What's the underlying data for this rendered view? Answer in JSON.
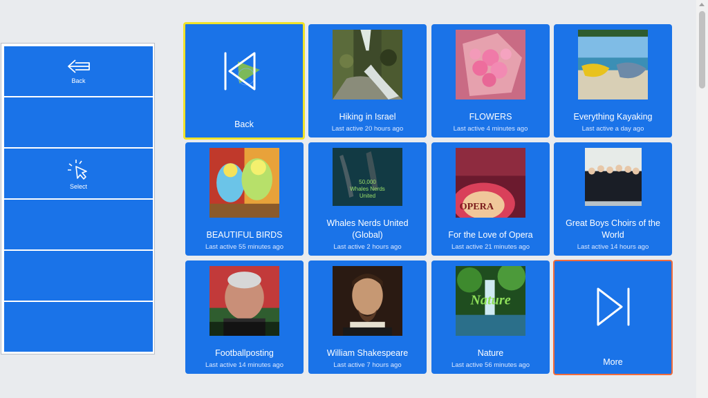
{
  "sidebar": {
    "back_label": "Back",
    "select_label": "Select",
    "back_icon": "arrow-left-icon",
    "select_icon": "pointer-click-icon"
  },
  "grid": {
    "back_tile": {
      "label": "Back",
      "icon": "skip-back-icon"
    },
    "more_tile": {
      "label": "More",
      "icon": "skip-forward-icon"
    },
    "groups": [
      {
        "name": "Hiking in Israel",
        "active": "Last active 20 hours ago",
        "thumb": "waterfall-forest"
      },
      {
        "name": "FLOWERS",
        "active": "Last active 4 minutes ago",
        "thumb": "pink-roses"
      },
      {
        "name": "Everything Kayaking",
        "active": "Last active a day ago",
        "thumb": "kayaks-beach"
      },
      {
        "name": "BEAUTIFUL BIRDS",
        "active": "Last active 55 minutes ago",
        "thumb": "parakeets"
      },
      {
        "name": "Whales Nerds United (Global)",
        "active": "Last active 2 hours ago",
        "thumb": "whales",
        "thumb_text": [
          "50,000",
          "Whales Nerds",
          "United"
        ]
      },
      {
        "name": "For the Love of Opera",
        "active": "Last active 21 minutes ago",
        "thumb": "opera-poster",
        "thumb_text": [
          "OPERA"
        ]
      },
      {
        "name": "Great Boys Choirs of the World",
        "active": "Last active 14 hours ago",
        "thumb": "boys-choir"
      },
      {
        "name": "Footballposting",
        "active": "Last active 14 minutes ago",
        "thumb": "football-man"
      },
      {
        "name": "William Shakespeare",
        "active": "Last active 7 hours ago",
        "thumb": "shakespeare-portrait"
      },
      {
        "name": "Nature",
        "active": "Last active 56 minutes ago",
        "thumb": "nature-waterfall",
        "thumb_text": [
          "Nature"
        ]
      }
    ]
  },
  "colors": {
    "tile": "#1a73e8",
    "selected_border": "#f0e22a",
    "hover_border": "#f26b3a",
    "background": "#e9ebee"
  }
}
